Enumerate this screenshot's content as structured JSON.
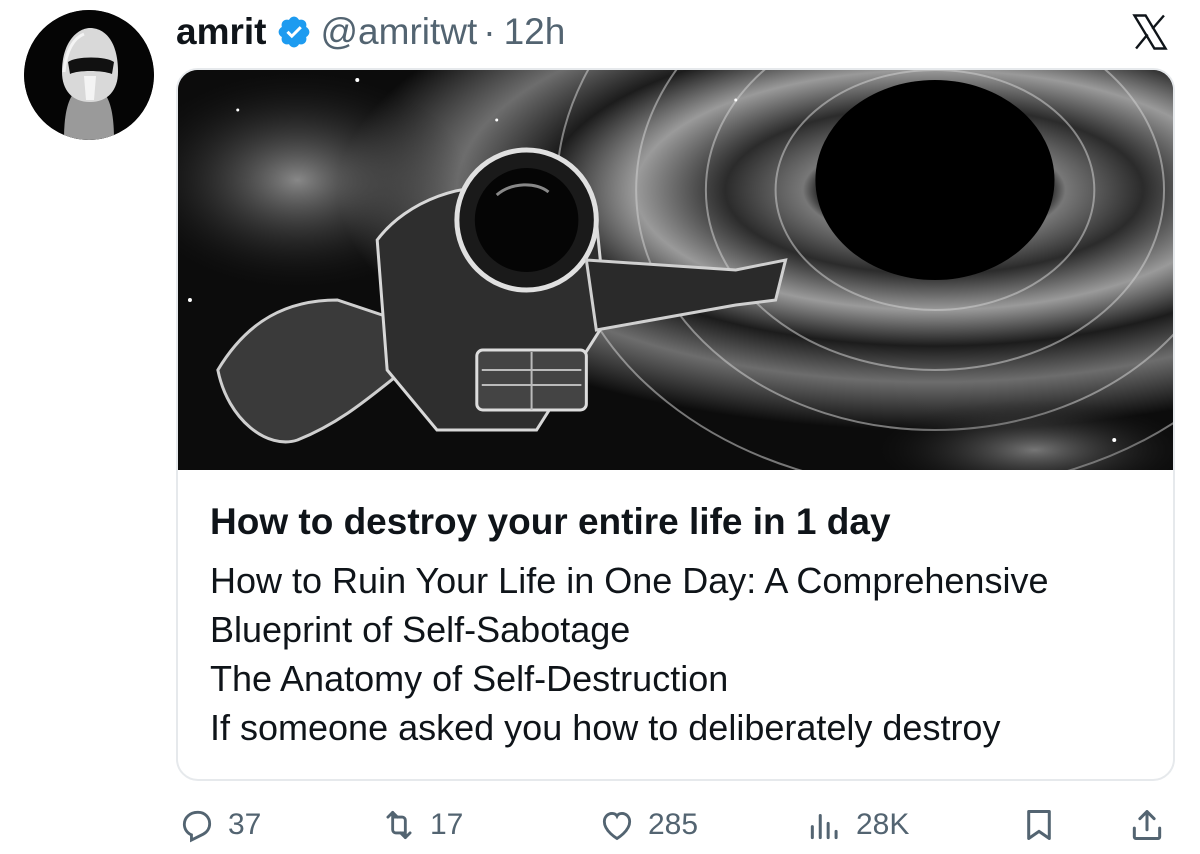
{
  "author": {
    "display_name": "amrit",
    "handle": "@amritwt",
    "separator": "·",
    "time": "12h",
    "verified": true
  },
  "platform_logo": "x-logo-icon",
  "card": {
    "image": "astronaut-blackhole-illustration",
    "title": "How to destroy your entire life in 1 day",
    "description_lines": [
      "How to Ruin Your Life in One Day: A Comprehensive",
      "Blueprint of Self-Sabotage",
      "The Anatomy of Self-Destruction",
      "If someone asked you how to deliberately destroy"
    ]
  },
  "actions": {
    "replies": "37",
    "reposts": "17",
    "likes": "285",
    "views": "28K"
  },
  "colors": {
    "verified_badge": "#1d9bf0",
    "secondary_text": "#536471",
    "primary_text": "#0f1419",
    "card_border": "#e6e9ec"
  }
}
